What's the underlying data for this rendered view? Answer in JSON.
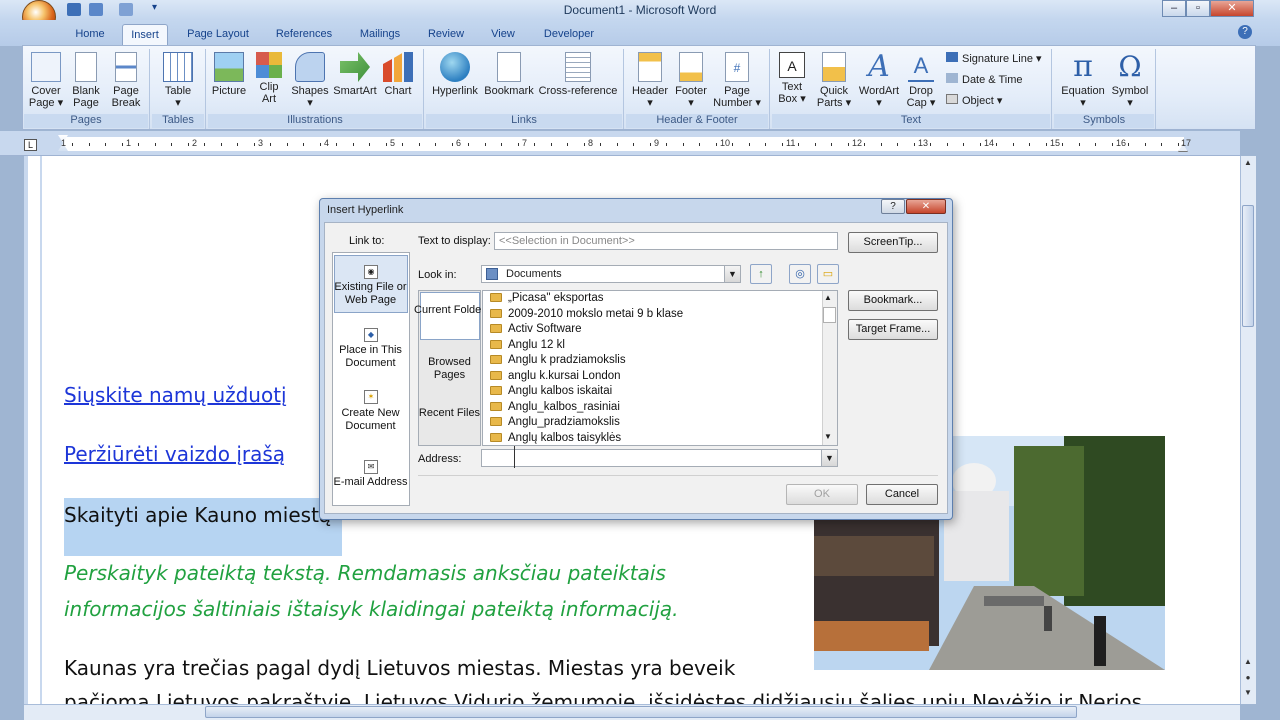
{
  "window": {
    "title": "Document1 - Microsoft Word"
  },
  "tabs": [
    {
      "label": "Home"
    },
    {
      "label": "Insert"
    },
    {
      "label": "Page Layout"
    },
    {
      "label": "References"
    },
    {
      "label": "Mailings"
    },
    {
      "label": "Review"
    },
    {
      "label": "View"
    },
    {
      "label": "Developer"
    }
  ],
  "ribbon": {
    "pages": {
      "label": "Pages",
      "cover": "Cover",
      "cover2": "Page ▾",
      "blank": "Blank",
      "blank2": "Page",
      "break": "Page",
      "break2": "Break"
    },
    "tables": {
      "label": "Tables",
      "table": "Table",
      "table2": "▾"
    },
    "illustrations": {
      "label": "Illustrations",
      "picture": "Picture",
      "clip": "Clip",
      "clip2": "Art",
      "shapes": "Shapes",
      "shapes2": "▾",
      "smartart": "SmartArt",
      "chart": "Chart"
    },
    "links": {
      "label": "Links",
      "hyperlink": "Hyperlink",
      "bookmark": "Bookmark",
      "crossref": "Cross-reference"
    },
    "header_footer": {
      "label": "Header & Footer",
      "header": "Header",
      "header2": "▾",
      "footer": "Footer",
      "footer2": "▾",
      "pagenum": "Page",
      "pagenum2": "Number ▾"
    },
    "text": {
      "label": "Text",
      "textbox": "Text",
      "textbox2": "Box ▾",
      "quick": "Quick",
      "quick2": "Parts ▾",
      "wordart": "WordArt",
      "wordart2": "▾",
      "dropcap": "Drop",
      "dropcap2": "Cap ▾",
      "signature": "Signature Line ▾",
      "datetime": "Date & Time",
      "object": "Object ▾"
    },
    "symbols": {
      "label": "Symbols",
      "equation": "Equation",
      "equation2": "▾",
      "symbol": "Symbol",
      "symbol2": "▾"
    }
  },
  "ruler": {
    "numbers": [
      "1",
      "1",
      "2",
      "3",
      "4",
      "5",
      "6",
      "7",
      "8",
      "9",
      "10",
      "11",
      "12",
      "13",
      "14",
      "15",
      "16",
      "17"
    ]
  },
  "document": {
    "link1": "Siųskite namų užduotį",
    "link2": "Peržiūrėti vaizdo įrašą",
    "selected": "Skaityti apie Kauno miestą",
    "green1": "Perskaityk pateiktą tekstą. Remdamasis anksčiau pateiktais",
    "green2": "informacijos šaltiniais  ištaisyk klaidingai pateiktą informaciją.",
    "body1": "Kaunas yra trečias pagal dydį Lietuvos miestas. Miestas yra beveik",
    "body2": "pačioma Lietuvos pakraštyje, Lietuvos Vidurio žemumoje, išsidėstęs didžiausių šalies upių Nevėžio ir Nerios"
  },
  "dialog": {
    "title": "Insert Hyperlink",
    "help": "?",
    "close": "✕",
    "link_to": "Link to:",
    "nav": {
      "existing": "Existing File or Web Page",
      "place": "Place in This Document",
      "create": "Create New Document",
      "email": "E-mail Address"
    },
    "text_display_label": "Text to display:",
    "text_display_value": "<<Selection in Document>>",
    "screentip": "ScreenTip...",
    "look_in_label": "Look in:",
    "look_in_value": "Documents",
    "current_folder": "Current Folder",
    "browsed_pages": "Browsed Pages",
    "recent_files": "Recent Files",
    "files": [
      "„Picasa\" eksportas",
      "2009-2010 mokslo metai   9 b klase",
      "Activ Software",
      "Anglu 12 kl",
      "Anglu k pradziamokslis",
      "anglu k.kursai London",
      "Anglu kalbos iskaitai",
      "Anglu_kalbos_rasiniai",
      "Anglu_pradziamokslis",
      "Anglų kalbos taisyklės"
    ],
    "bookmark": "Bookmark...",
    "target_frame": "Target Frame...",
    "address_label": "Address:",
    "address_value": "",
    "ok": "OK",
    "cancel": "Cancel"
  },
  "colors": {
    "link": "#1d36d8",
    "green": "#21a140",
    "selection": "#b6d4f2"
  }
}
